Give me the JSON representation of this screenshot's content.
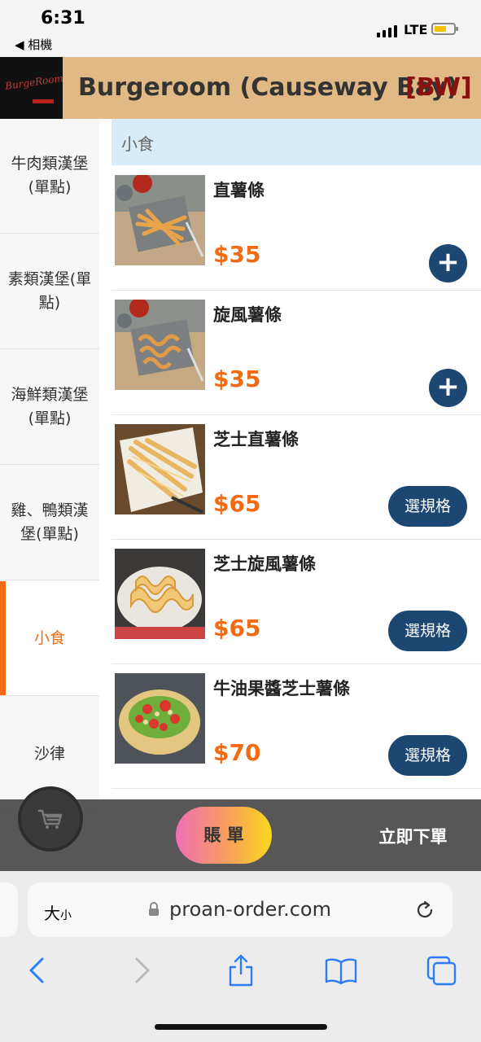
{
  "status": {
    "time": "6:31",
    "back_app": "◀ 相機",
    "network": "LTE"
  },
  "header": {
    "logo_text": "BurgeRoom",
    "title": "Burgeroom (Causeway Bay)",
    "badge": "[BW]"
  },
  "sidebar": {
    "categories": [
      {
        "label": "牛肉類漢堡(單點)"
      },
      {
        "label": "素類漢堡(單點)"
      },
      {
        "label": "海鮮類漢堡(單點)"
      },
      {
        "label": "雞、鴨類漢堡(單點)"
      },
      {
        "label": "小食",
        "active": true
      },
      {
        "label": "沙律"
      }
    ]
  },
  "section": {
    "title": "小食"
  },
  "items": [
    {
      "name": "直薯條",
      "price": "$35",
      "action": "+"
    },
    {
      "name": "旋風薯條",
      "price": "$35",
      "action": "+"
    },
    {
      "name": "芝士直薯條",
      "price": "$65",
      "action": "選規格"
    },
    {
      "name": "芝士旋風薯條",
      "price": "$65",
      "action": "選規格"
    },
    {
      "name": "牛油果醬芝士薯條",
      "price": "$70",
      "action": "選規格"
    }
  ],
  "bottom_bar": {
    "bill_label": "賬 單",
    "order_label": "立即下單"
  },
  "browser": {
    "text_size_label_big": "大",
    "text_size_label_small": "小",
    "url": "proan-order.com"
  },
  "colors": {
    "accent": "#f26a12",
    "primary_button": "#1d4773",
    "header_bg": "#e1b984",
    "section_bg": "#d7ebf8",
    "brand_badge": "#8b1010"
  }
}
